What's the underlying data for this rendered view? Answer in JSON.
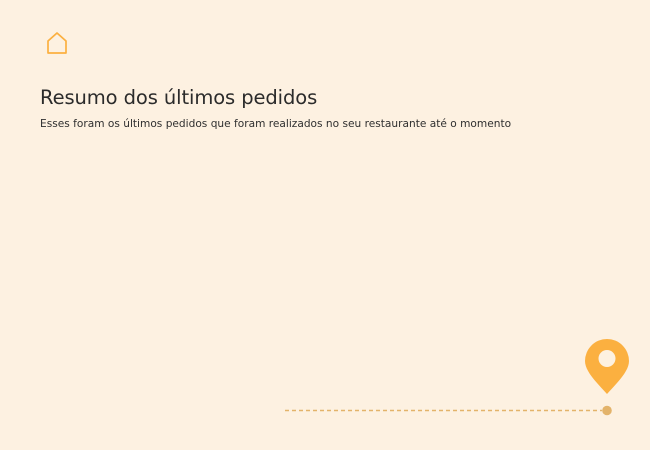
{
  "page": {
    "background": "#fdf1e1",
    "accent": "#fbb040",
    "muted_accent": "#e3b36a"
  },
  "header": {
    "home_icon": "home-icon"
  },
  "summary": {
    "title": "Resumo dos últimos pedidos",
    "subtitle": "Esses foram os últimos pedidos que foram realizados no seu restaurante até o momento"
  },
  "illustration": {
    "pin_icon": "map-pin-icon",
    "path_style": "dashed"
  }
}
